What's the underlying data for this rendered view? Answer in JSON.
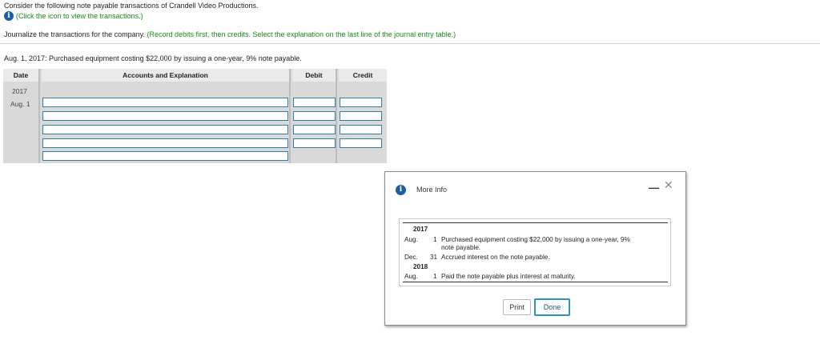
{
  "header": {
    "intro": "Consider the following note payable transactions of Crandell Video Productions.",
    "link": "(Click the icon to view the transactions.)",
    "instruction": "Journalize the transactions for the company.",
    "instruction_note": "(Record debits first, then credits. Select the explanation on the last line of the journal entry table.)"
  },
  "question": {
    "text": "Aug. 1, 2017: Purchased equipment costing $22,000 by issuing a one-year, 9% note payable."
  },
  "journal_table": {
    "headers": [
      "Date",
      "Accounts and Explanation",
      "Debit",
      "Credit"
    ],
    "year": "2017",
    "date": "Aug. 1"
  },
  "modal": {
    "title": "More Info",
    "minimize_glyph": "—",
    "close_glyph": "✕",
    "transactions": {
      "year_1": "2017",
      "rows_1": [
        {
          "month": "Aug.",
          "day": "1",
          "desc_line1": "Purchased equipment costing $22,000 by issuing a one-year, 9%",
          "desc_line2": "note payable."
        },
        {
          "month": "Dec.",
          "day": "31",
          "desc_line1": "Accrued interest on the note payable.",
          "desc_line2": ""
        }
      ],
      "year_2": "2018",
      "rows_2": [
        {
          "month": "Aug.",
          "day": "1",
          "desc_line1": "Paid the note payable plus interest at maturity.",
          "desc_line2": ""
        }
      ]
    },
    "print_label": "Print",
    "done_label": "Done"
  }
}
